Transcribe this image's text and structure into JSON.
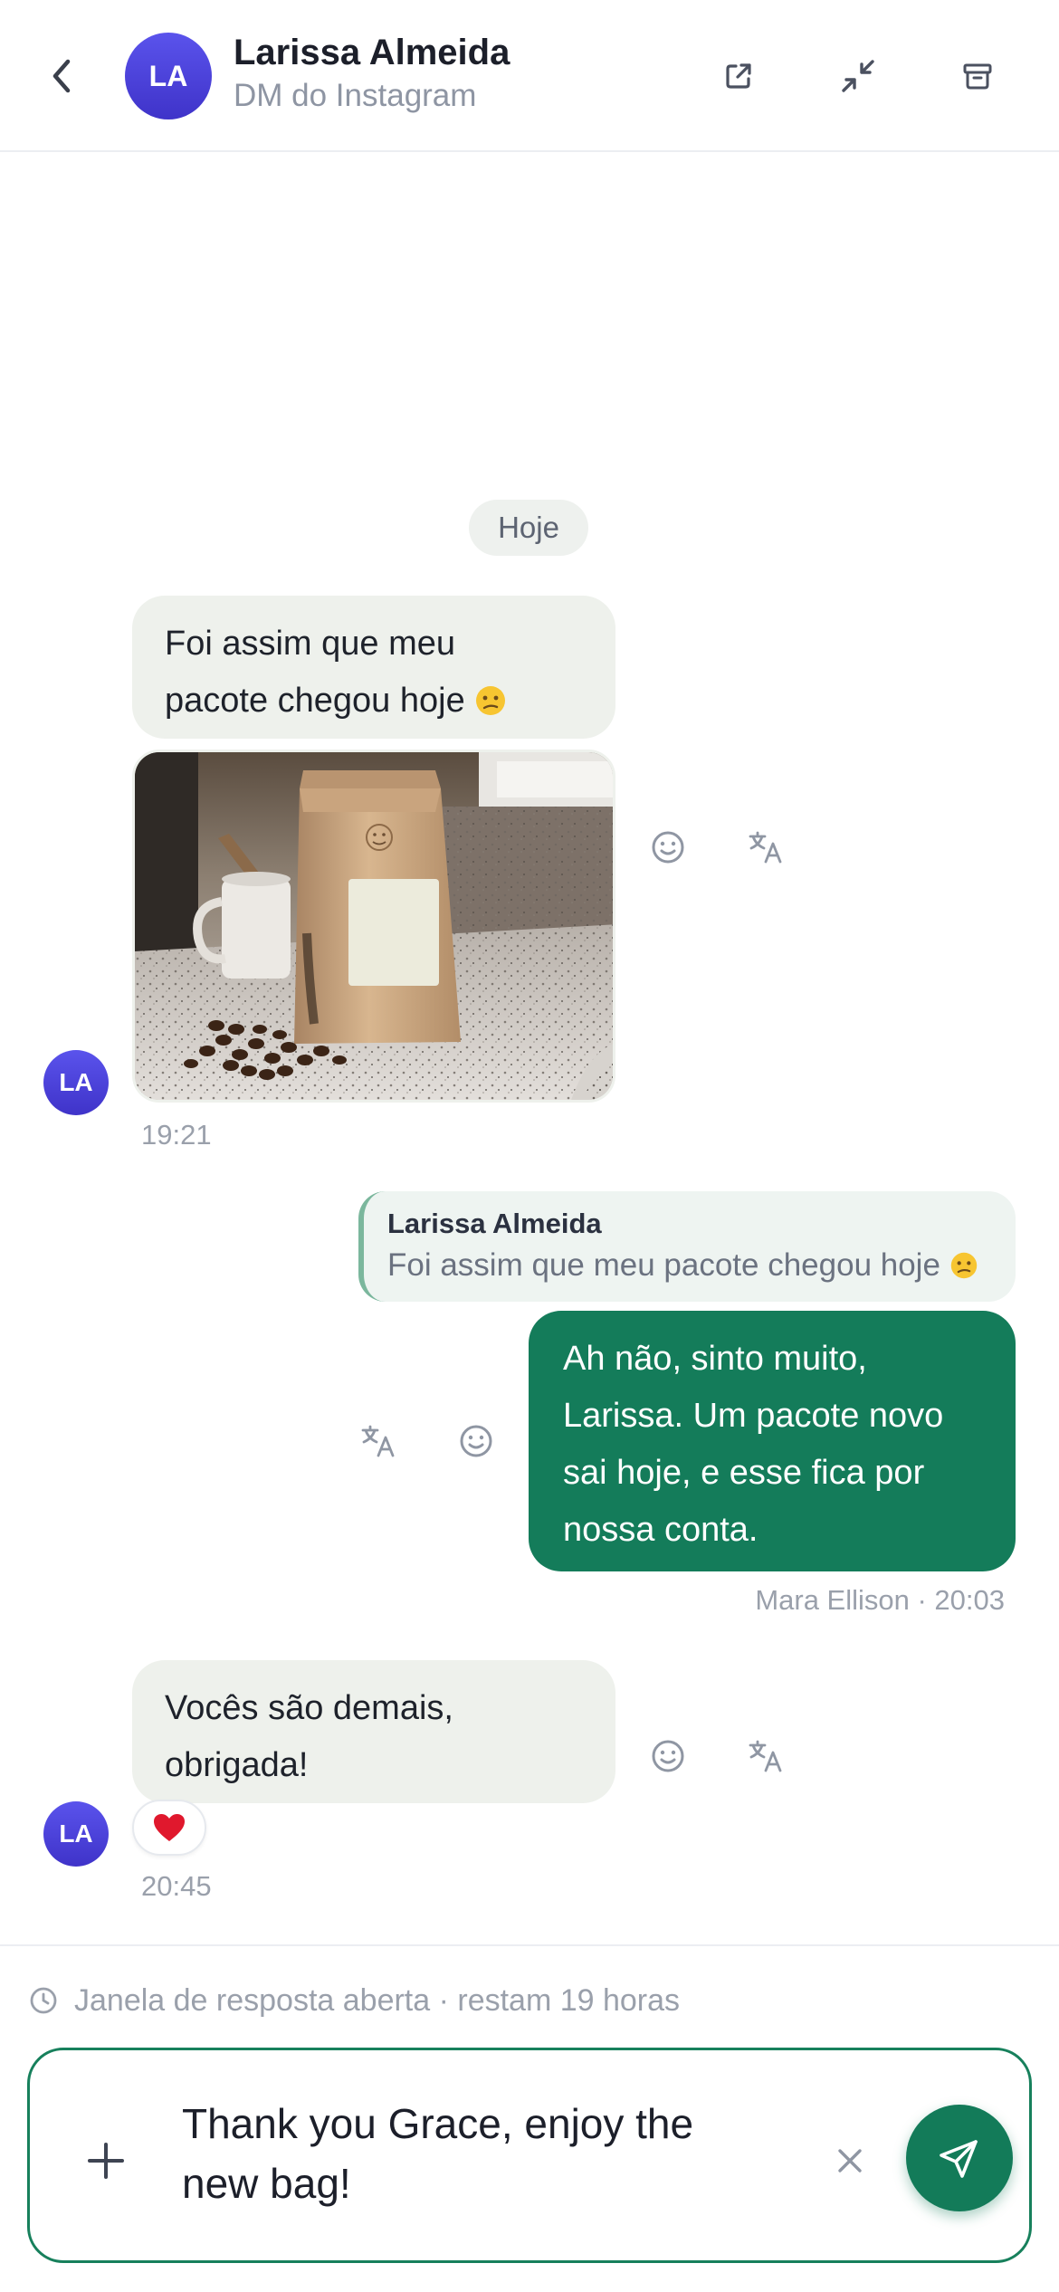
{
  "header": {
    "avatar_initials": "LA",
    "contact_name": "Larissa Almeida",
    "channel": "DM do Instagram",
    "icons": [
      "back-chevron-icon",
      "open-external-icon",
      "minimize-icon",
      "archive-icon"
    ]
  },
  "conversation": {
    "day_label": "Hoje",
    "messages": [
      {
        "direction": "incoming",
        "avatar_initials": "LA",
        "text_line1": "Foi assim que meu",
        "text_line2": "pacote chegou hoje",
        "emoji": "confused-face",
        "attachment": "photo-coffee-bag",
        "time": "19:21"
      },
      {
        "direction": "outgoing",
        "reply_to_name": "Larissa Almeida",
        "reply_to_text": "Foi assim que meu pacote chegou hoje",
        "text_lines": [
          "Ah não, sinto muito,",
          "Larissa. Um pacote novo",
          "sai hoje, e esse fica por",
          "nossa conta."
        ],
        "meta": "Mara Ellison · 20:03"
      },
      {
        "direction": "incoming",
        "avatar_initials": "LA",
        "text_line1": "Vocês são demais,",
        "text_line2": "obrigada!",
        "reaction": "❤️",
        "time": "20:45"
      }
    ]
  },
  "composer": {
    "window_note": "Janela de resposta aberta · restam 19 horas",
    "draft_line1": "Thank you Grace, enjoy the",
    "draft_line2": "new bag!"
  },
  "colors": {
    "accent_green": "#147c5a",
    "avatar_purple": "#4a40dc",
    "incoming_bubble": "#eef1ec"
  }
}
